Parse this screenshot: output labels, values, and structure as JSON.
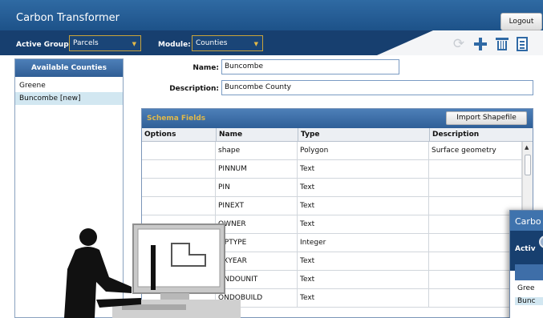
{
  "app": {
    "title": "Carbon Transformer",
    "logout_label": "Logout"
  },
  "toolbar": {
    "active_group_label": "Active Group:",
    "active_group_value": "Parcels",
    "module_label": "Module:",
    "module_value": "Counties",
    "icons": [
      "refresh-icon",
      "add-icon",
      "trash-icon",
      "document-icon"
    ]
  },
  "sidebar": {
    "header": "Available Counties",
    "items": [
      {
        "label": "Greene",
        "selected": false
      },
      {
        "label": "Buncombe [new]",
        "selected": true
      }
    ]
  },
  "form": {
    "name_label": "Name:",
    "name_value": "Buncombe",
    "description_label": "Description:",
    "description_value": "Buncombe County"
  },
  "schema": {
    "title": "Schema Fields",
    "import_label": "Import Shapefile",
    "columns": [
      "Options",
      "Name",
      "Type",
      "Description"
    ],
    "rows": [
      {
        "options": "",
        "name": "shape",
        "type": "Polygon",
        "description": "Surface geometry"
      },
      {
        "options": "",
        "name": "PINNUM",
        "type": "Text",
        "description": ""
      },
      {
        "options": "",
        "name": "PIN",
        "type": "Text",
        "description": ""
      },
      {
        "options": "",
        "name": "PINEXT",
        "type": "Text",
        "description": ""
      },
      {
        "options": "",
        "name": "OWNER",
        "type": "Text",
        "description": ""
      },
      {
        "options": "",
        "name": "MPTYPE",
        "type": "Integer",
        "description": ""
      },
      {
        "options": "",
        "name": "AXYEAR",
        "type": "Text",
        "description": ""
      },
      {
        "options": "",
        "name": "ONDOUNIT",
        "type": "Text",
        "description": ""
      },
      {
        "options": "",
        "name": "ONDOBUILD",
        "type": "Text",
        "description": ""
      }
    ]
  },
  "overlay_window": {
    "title_fragment": "Carbo",
    "toolbar_fragment": "Activ",
    "items": [
      "Gree",
      "Bunc"
    ]
  },
  "colors": {
    "title_bar": "#2f6aa3",
    "toolbar": "#173f6f",
    "panel_header": "#4d7fb8",
    "schema_title": "#e0b94a",
    "selected_row": "#d2e7f1"
  }
}
